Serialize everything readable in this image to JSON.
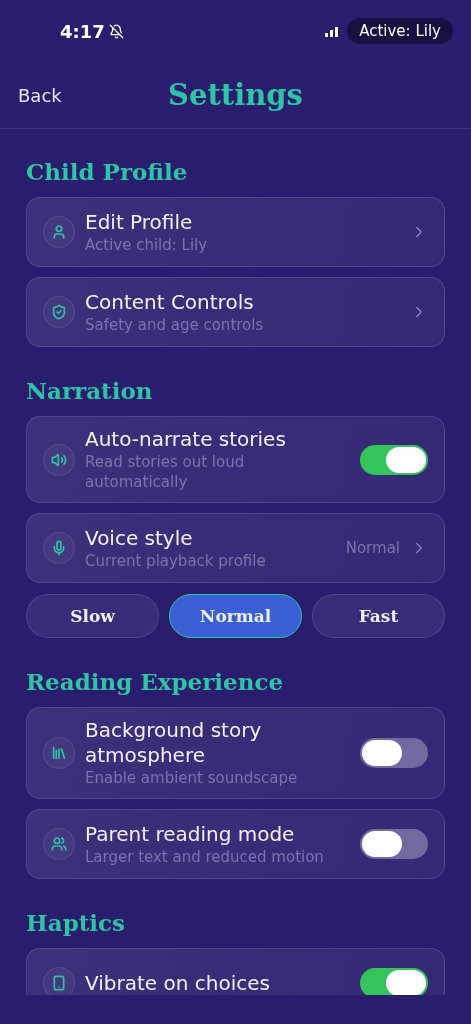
{
  "status_bar": {
    "time": "4:17",
    "pill": "Active: Lily"
  },
  "header": {
    "back": "Back",
    "title": "Settings"
  },
  "sections": [
    {
      "title": "Child Profile",
      "items": [
        {
          "kind": "link",
          "title": "Edit Profile",
          "subtitle": "Active child: Lily"
        },
        {
          "kind": "link",
          "title": "Content Controls",
          "subtitle": "Safety and age controls"
        }
      ]
    },
    {
      "title": "Narration",
      "items": [
        {
          "kind": "toggle",
          "title": "Auto-narrate stories",
          "subtitle": "Read stories out loud automatically",
          "on": true
        },
        {
          "kind": "value",
          "title": "Voice style",
          "subtitle": "Current playback profile",
          "value": "Normal"
        },
        {
          "kind": "segments",
          "options": [
            {
              "label": "Slow",
              "selected": false
            },
            {
              "label": "Normal",
              "selected": true
            },
            {
              "label": "Fast",
              "selected": false
            }
          ]
        }
      ]
    },
    {
      "title": "Reading Experience",
      "items": [
        {
          "kind": "toggle",
          "title": "Background story atmosphere",
          "subtitle": "Enable ambient soundscape",
          "on": false
        },
        {
          "kind": "toggle",
          "title": "Parent reading mode",
          "subtitle": "Larger text and reduced motion",
          "on": false
        }
      ]
    },
    {
      "title": "Haptics",
      "items": [
        {
          "kind": "toggle",
          "title": "Vibrate on choices",
          "on": true
        }
      ]
    }
  ]
}
